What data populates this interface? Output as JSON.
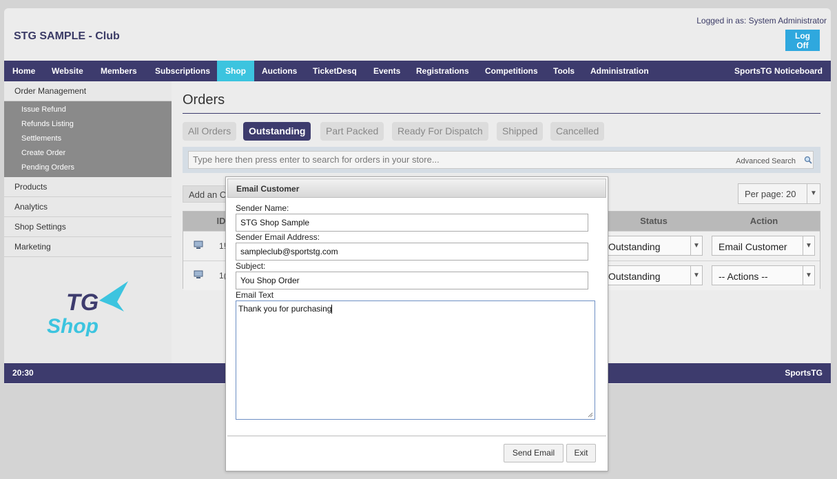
{
  "header": {
    "club_title": "STG SAMPLE - Club",
    "logged_in": "Logged in as: System Administrator",
    "log_off": "Log Off"
  },
  "nav": {
    "items": [
      "Home",
      "Website",
      "Members",
      "Subscriptions",
      "Shop",
      "Auctions",
      "TicketDesq",
      "Events",
      "Registrations",
      "Competitions",
      "Tools",
      "Administration"
    ],
    "active": "Shop",
    "right": "SportsTG Noticeboard"
  },
  "sidebar": {
    "heading": "Order Management",
    "sub_items": [
      "Issue Refund",
      "Refunds Listing",
      "Settlements",
      "Create Order",
      "Pending Orders"
    ],
    "items": [
      "Products",
      "Analytics",
      "Shop Settings",
      "Marketing"
    ],
    "logo": {
      "top": "TG",
      "bottom": "Shop"
    }
  },
  "main": {
    "title": "Orders",
    "tabs": [
      "All Orders",
      "Outstanding",
      "Part Packed",
      "Ready For Dispatch",
      "Shipped",
      "Cancelled"
    ],
    "active_tab": "Outstanding",
    "search_placeholder": "Type here then press enter to search for orders in your store...",
    "advanced_search": "Advanced Search",
    "add_button": "Add an O",
    "per_page": "Per page: 20",
    "columns": {
      "id": "ID",
      "status": "Status",
      "action": "Action"
    },
    "rows": [
      {
        "id": "1!",
        "status": "Outstanding",
        "action": "Email Customer"
      },
      {
        "id": "1(",
        "status": "Outstanding",
        "action": "-- Actions --"
      }
    ]
  },
  "footer": {
    "time": "20:30",
    "right": "SportsTG"
  },
  "dialog": {
    "title": "Email Customer",
    "sender_name_label": "Sender Name:",
    "sender_name_value": "STG Shop Sample",
    "sender_email_label": "Sender Email Address:",
    "sender_email_value": "sampleclub@sportstg.com",
    "subject_label": "Subject:",
    "subject_value": "You Shop Order",
    "email_text_label": "Email Text",
    "email_text_value": "Thank you for purchasing",
    "send_button": "Send Email",
    "exit_button": "Exit"
  },
  "colors": {
    "nav_bg": "#3d3b6d",
    "active_nav": "#3cc4df",
    "logoff": "#2fa8de"
  }
}
